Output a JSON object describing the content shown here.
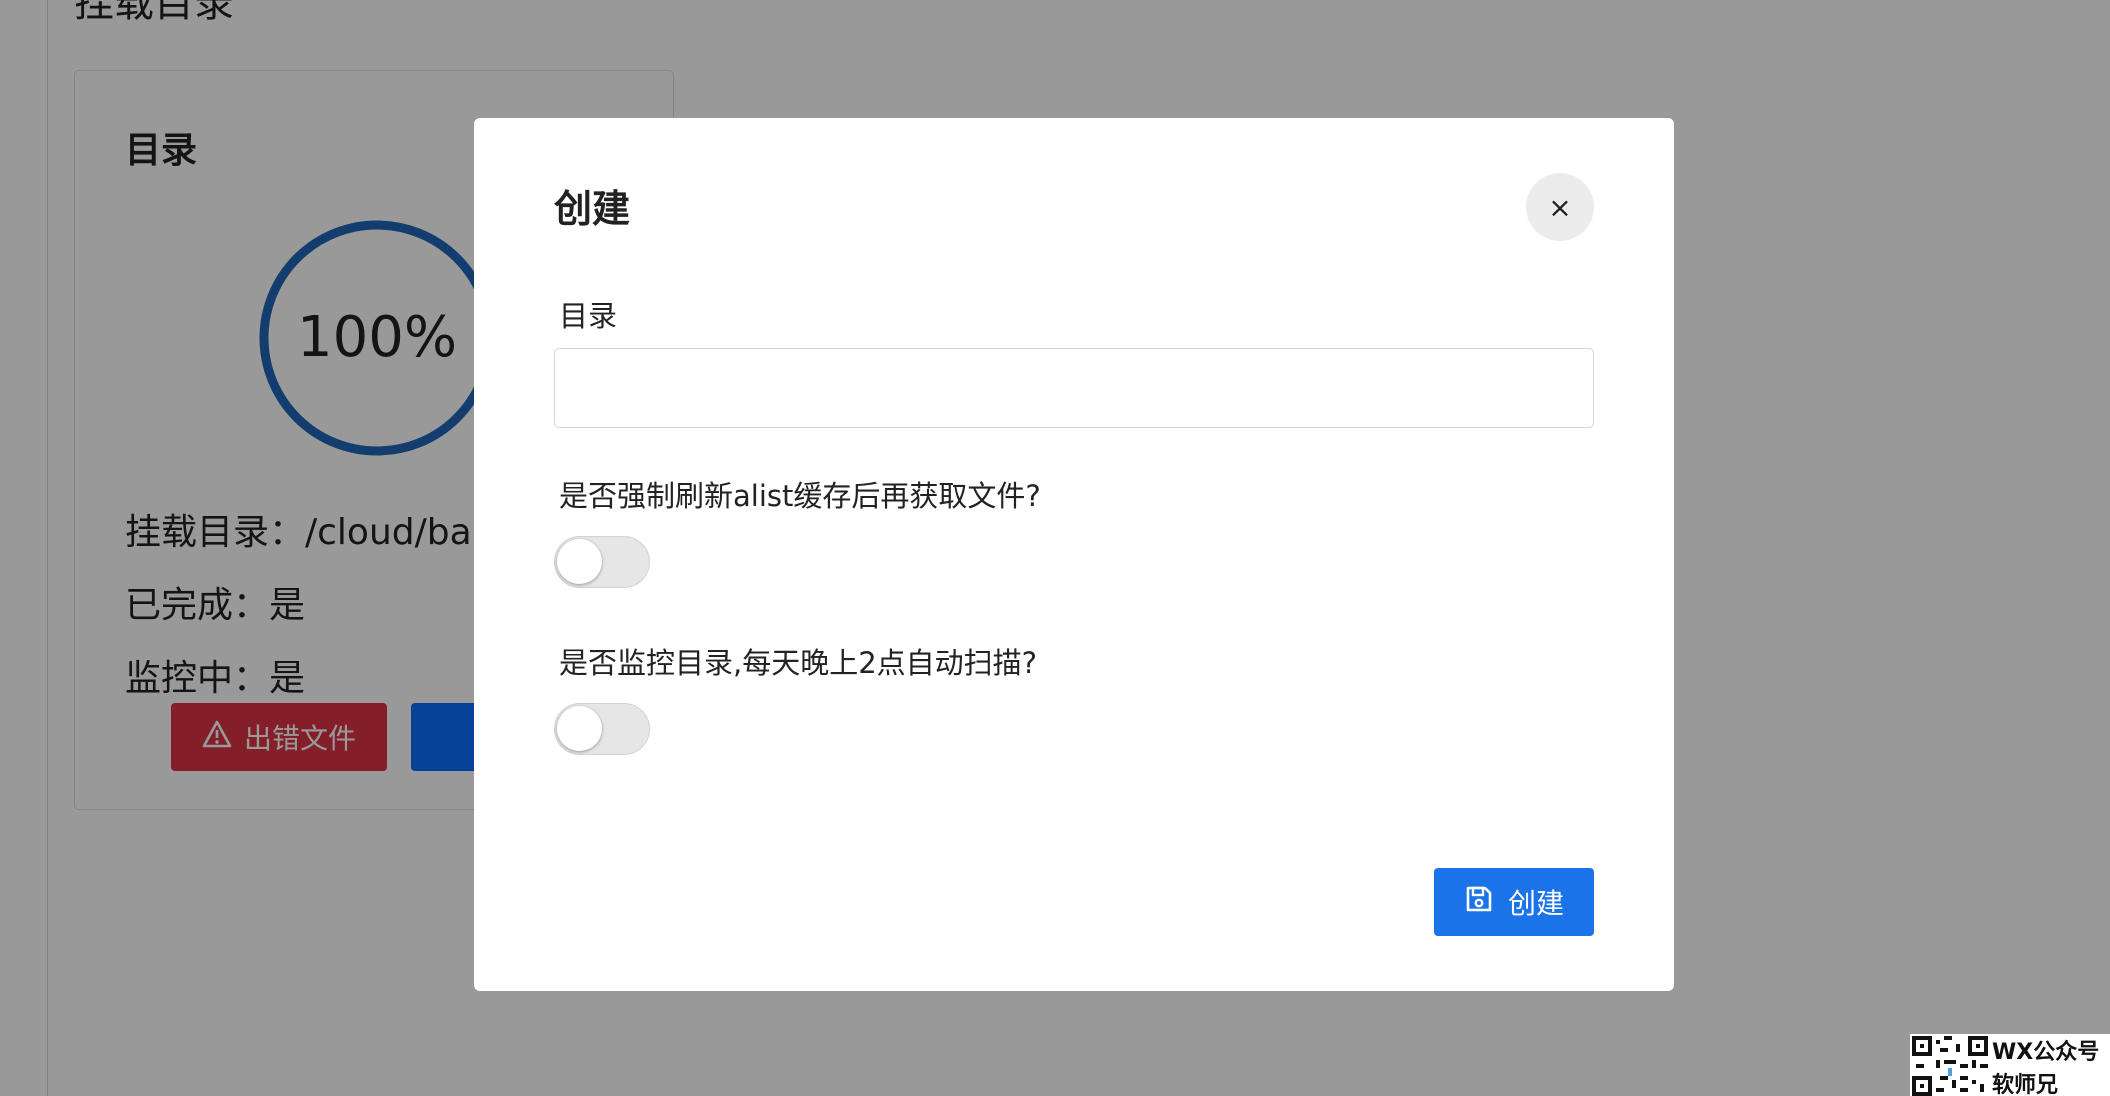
{
  "background": {
    "heading": "挂载目录",
    "card": {
      "title": "目录",
      "progress": {
        "percent": 100,
        "label": "100%",
        "color": "#1f66b8"
      },
      "mount_dir_line": "挂载目录：/cloud/baidu",
      "completed_line": "已完成：是",
      "monitoring_line": "监控中：是",
      "error_button_label": "出错文件",
      "error_button_icon": "warning-icon",
      "add_button_label": "",
      "add_button_icon": "plus-circle-icon"
    }
  },
  "modal": {
    "title": "创建",
    "close_label": "×",
    "directory": {
      "label": "目录",
      "value": "",
      "placeholder": ""
    },
    "refresh_cache": {
      "label": "是否强制刷新alist缓存后再获取文件?",
      "enabled": false
    },
    "monitor": {
      "label": "是否监控目录,每天晚上2点自动扫描?",
      "enabled": false
    },
    "submit": {
      "label": "创建",
      "icon": "save-icon"
    }
  },
  "watermark": {
    "line1": "WX公众号",
    "line2": "软师兄"
  },
  "colors": {
    "overlay": "rgba(0,0,0,0.40)",
    "primary": "#1a73e8",
    "danger": "#dc3545",
    "progress": "#1f66b8"
  }
}
